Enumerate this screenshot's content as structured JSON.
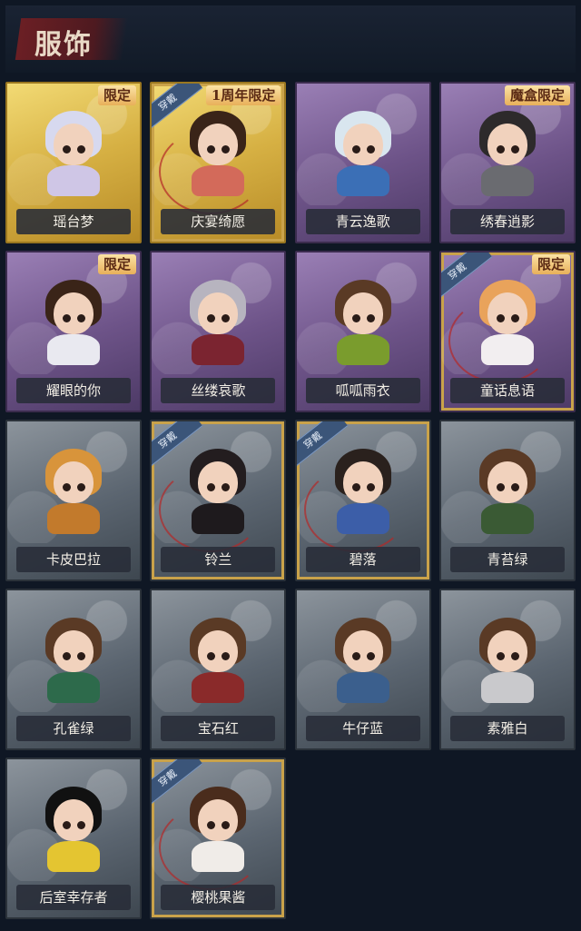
{
  "header": {
    "title": "服饰"
  },
  "badges": {
    "worn": "穿戴"
  },
  "items": [
    {
      "name": "瑶台梦",
      "rarity": "gold",
      "badge": "限定",
      "worn": false,
      "hair": "#d7d9ef",
      "outfit": "#cfc6e6"
    },
    {
      "name": "庆宴绮愿",
      "rarity": "gold",
      "badge": "1周年限定",
      "worn": true,
      "hair": "#3a2418",
      "outfit": "#d36a5a"
    },
    {
      "name": "青云逸歌",
      "rarity": "purple",
      "badge": "",
      "worn": false,
      "hair": "#d9e6ef",
      "outfit": "#3b6fb6"
    },
    {
      "name": "绣春逍影",
      "rarity": "purple",
      "badge": "魔盒限定",
      "worn": false,
      "hair": "#2d2a2b",
      "outfit": "#6a6b70"
    },
    {
      "name": "耀眼的你",
      "rarity": "purple",
      "badge": "限定",
      "worn": false,
      "hair": "#3a2418",
      "outfit": "#e9e9f0"
    },
    {
      "name": "丝缕哀歌",
      "rarity": "purple",
      "badge": "",
      "worn": false,
      "hair": "#b7b4bf",
      "outfit": "#7b2430"
    },
    {
      "name": "呱呱雨衣",
      "rarity": "purple",
      "badge": "",
      "worn": false,
      "hair": "#5a3a25",
      "outfit": "#7a9c2d"
    },
    {
      "name": "童话息语",
      "rarity": "purple",
      "badge": "限定",
      "worn": true,
      "hair": "#e9a35b",
      "outfit": "#f2eef0"
    },
    {
      "name": "卡皮巴拉",
      "rarity": "grey",
      "badge": "",
      "worn": false,
      "hair": "#d8943b",
      "outfit": "#c27a2c"
    },
    {
      "name": "铃兰",
      "rarity": "grey",
      "badge": "",
      "worn": true,
      "hair": "#231d1f",
      "outfit": "#1e1a1d"
    },
    {
      "name": "碧落",
      "rarity": "grey",
      "badge": "",
      "worn": true,
      "hair": "#2a211d",
      "outfit": "#3c5ea8"
    },
    {
      "name": "青苔绿",
      "rarity": "grey",
      "badge": "",
      "worn": false,
      "hair": "#5a3a25",
      "outfit": "#3a5a34"
    },
    {
      "name": "孔雀绿",
      "rarity": "grey",
      "badge": "",
      "worn": false,
      "hair": "#5a3a25",
      "outfit": "#2d6a4b"
    },
    {
      "name": "宝石红",
      "rarity": "grey",
      "badge": "",
      "worn": false,
      "hair": "#5a3a25",
      "outfit": "#8a2a2a"
    },
    {
      "name": "牛仔蓝",
      "rarity": "grey",
      "badge": "",
      "worn": false,
      "hair": "#5a3a25",
      "outfit": "#3b5f8d"
    },
    {
      "name": "素雅白",
      "rarity": "grey",
      "badge": "",
      "worn": false,
      "hair": "#5a3a25",
      "outfit": "#c9c9cc"
    },
    {
      "name": "后室幸存者",
      "rarity": "grey",
      "badge": "",
      "worn": false,
      "hair": "#111111",
      "outfit": "#e4c531"
    },
    {
      "name": "樱桃果酱",
      "rarity": "grey",
      "badge": "",
      "worn": true,
      "hair": "#4a2c1c",
      "outfit": "#f0ece8"
    }
  ]
}
